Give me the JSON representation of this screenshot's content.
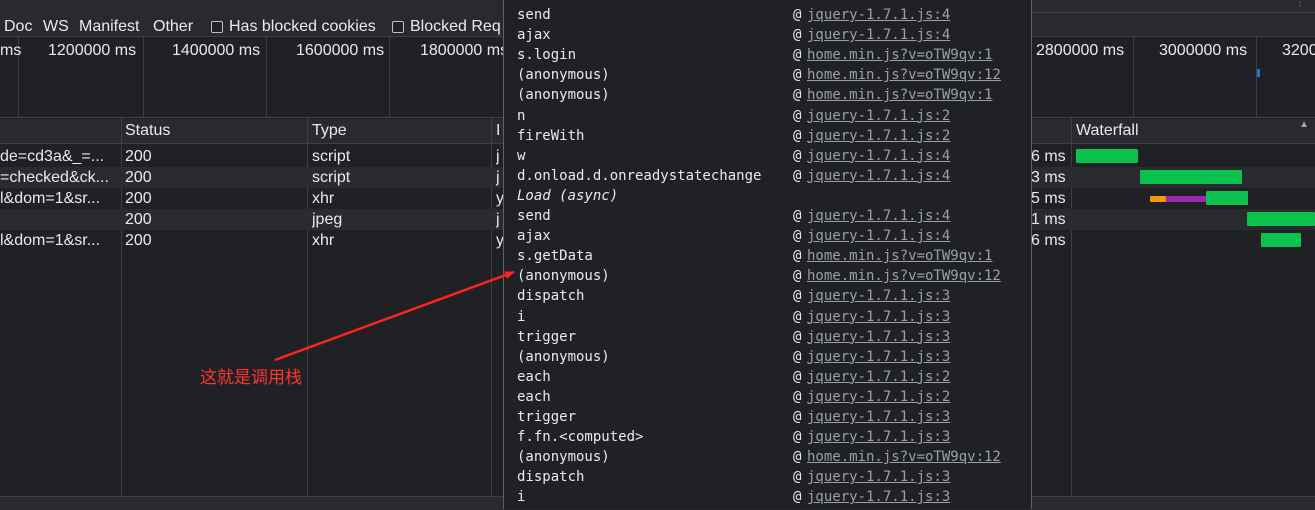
{
  "filter_bar": {
    "types": [
      "Doc",
      "WS",
      "Manifest",
      "Other"
    ],
    "checkboxes": [
      "Has blocked cookies",
      "Blocked Req"
    ]
  },
  "overview": {
    "tick_labels": [
      "ms",
      "1200000 ms",
      "1400000 ms",
      "1600000 ms",
      "1800000 ms",
      "2800000 ms",
      "3000000 ms",
      "3200"
    ]
  },
  "columns": {
    "status": "Status",
    "type": "Type",
    "initiator": "I",
    "waterfall": "Waterfall"
  },
  "rows": [
    {
      "name": "de=cd3a&_=...",
      "status": "200",
      "type": "script",
      "initiator": "j",
      "time": "6 ms"
    },
    {
      "name": "=checked&ck...",
      "status": "200",
      "type": "script",
      "initiator": "j",
      "time": "3 ms"
    },
    {
      "name": "l&dom=1&sr...",
      "status": "200",
      "type": "xhr",
      "initiator": "y",
      "time": "5 ms"
    },
    {
      "name": "",
      "status": "200",
      "type": "jpeg",
      "initiator": "j",
      "time": "1 ms"
    },
    {
      "name": "l&dom=1&sr...",
      "status": "200",
      "type": "xhr",
      "initiator": "y",
      "time": "6 ms"
    }
  ],
  "call_stack": [
    {
      "fn": "send",
      "src": "jquery-1.7.1.js:4"
    },
    {
      "fn": "ajax",
      "src": "jquery-1.7.1.js:4"
    },
    {
      "fn": "s.login",
      "src": "home.min.js?v=oTW9qv:1"
    },
    {
      "fn": "(anonymous)",
      "src": "home.min.js?v=oTW9qv:12"
    },
    {
      "fn": "(anonymous)",
      "src": "home.min.js?v=oTW9qv:1"
    },
    {
      "fn": "n",
      "src": "jquery-1.7.1.js:2"
    },
    {
      "fn": "fireWith",
      "src": "jquery-1.7.1.js:2"
    },
    {
      "fn": "w",
      "src": "jquery-1.7.1.js:4"
    },
    {
      "fn": "d.onload.d.onreadystatechange",
      "src": "jquery-1.7.1.js:4"
    },
    {
      "fn": "Load (async)",
      "src": "",
      "async": true
    },
    {
      "fn": "send",
      "src": "jquery-1.7.1.js:4"
    },
    {
      "fn": "ajax",
      "src": "jquery-1.7.1.js:4"
    },
    {
      "fn": "s.getData",
      "src": "home.min.js?v=oTW9qv:1"
    },
    {
      "fn": "(anonymous)",
      "src": "home.min.js?v=oTW9qv:12"
    },
    {
      "fn": "dispatch",
      "src": "jquery-1.7.1.js:3"
    },
    {
      "fn": "i",
      "src": "jquery-1.7.1.js:3"
    },
    {
      "fn": "trigger",
      "src": "jquery-1.7.1.js:3"
    },
    {
      "fn": "(anonymous)",
      "src": "jquery-1.7.1.js:3"
    },
    {
      "fn": "each",
      "src": "jquery-1.7.1.js:2"
    },
    {
      "fn": "each",
      "src": "jquery-1.7.1.js:2"
    },
    {
      "fn": "trigger",
      "src": "jquery-1.7.1.js:3"
    },
    {
      "fn": "f.fn.<computed>",
      "src": "jquery-1.7.1.js:3"
    },
    {
      "fn": "(anonymous)",
      "src": "home.min.js?v=oTW9qv:12"
    },
    {
      "fn": "dispatch",
      "src": "jquery-1.7.1.js:3"
    },
    {
      "fn": "i",
      "src": "jquery-1.7.1.js:3"
    }
  ],
  "at_symbol": "@",
  "annotation": "这就是调用栈",
  "colors": {
    "waterfall_green": "#0cc24f",
    "waterfall_orange": "#f29900",
    "waterfall_purple": "#9c27b0",
    "waterfall_blue": "#1a73e8",
    "annotation_red": "#ff2222"
  }
}
